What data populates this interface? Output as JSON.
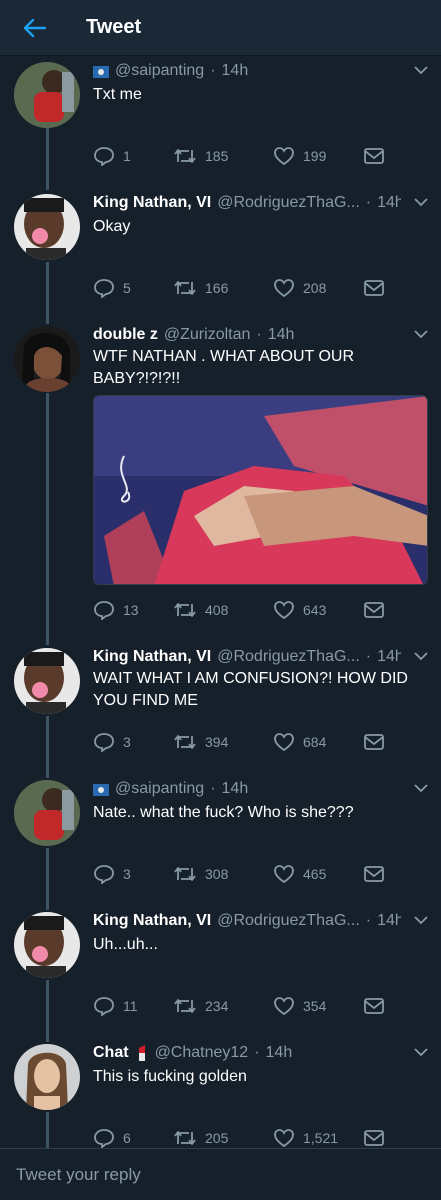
{
  "header": {
    "title": "Tweet",
    "back_icon": "arrow-left-icon"
  },
  "colors": {
    "background": "#15202b",
    "accent": "#1da1f2",
    "muted": "#8899a6",
    "thread_line": "#3d5466"
  },
  "tweets": [
    {
      "name": "",
      "handle": "@saipanting",
      "time": "14h",
      "badge": "flag-icon",
      "text": "Txt me",
      "replies": "1",
      "retweets": "185",
      "likes": "199"
    },
    {
      "name": "King Nathan, VI",
      "handle": "@RodriguezThaG...",
      "time": "14h",
      "text": "Okay",
      "replies": "5",
      "retweets": "166",
      "likes": "208"
    },
    {
      "name": "double z",
      "handle": "@Zurizoltan",
      "time": "14h",
      "text": "WTF NATHAN . WHAT ABOUT OUR BABY?!?!?!!",
      "has_media": true,
      "replies": "13",
      "retweets": "408",
      "likes": "643"
    },
    {
      "name": "King Nathan, VI",
      "handle": "@RodriguezThaG...",
      "time": "14h",
      "text": "WAIT WHAT I AM CONFUSION?!  HOW DID YOU FIND ME",
      "replies": "3",
      "retweets": "394",
      "likes": "684"
    },
    {
      "name": "",
      "handle": "@saipanting",
      "time": "14h",
      "badge": "flag-icon",
      "text": "Nate.. what the fuck? Who is she???",
      "replies": "3",
      "retweets": "308",
      "likes": "465"
    },
    {
      "name": "King Nathan, VI",
      "handle": "@RodriguezThaG...",
      "time": "14h",
      "text": "Uh...uh...",
      "replies": "11",
      "retweets": "234",
      "likes": "354"
    },
    {
      "name": "Chat",
      "handle": "@Chatney12",
      "time": "14h",
      "badge": "lipstick-icon",
      "text": "This is fucking golden",
      "replies": "6",
      "retweets": "205",
      "likes": "1,521"
    }
  ],
  "reply_box": {
    "placeholder": "Tweet your reply"
  }
}
